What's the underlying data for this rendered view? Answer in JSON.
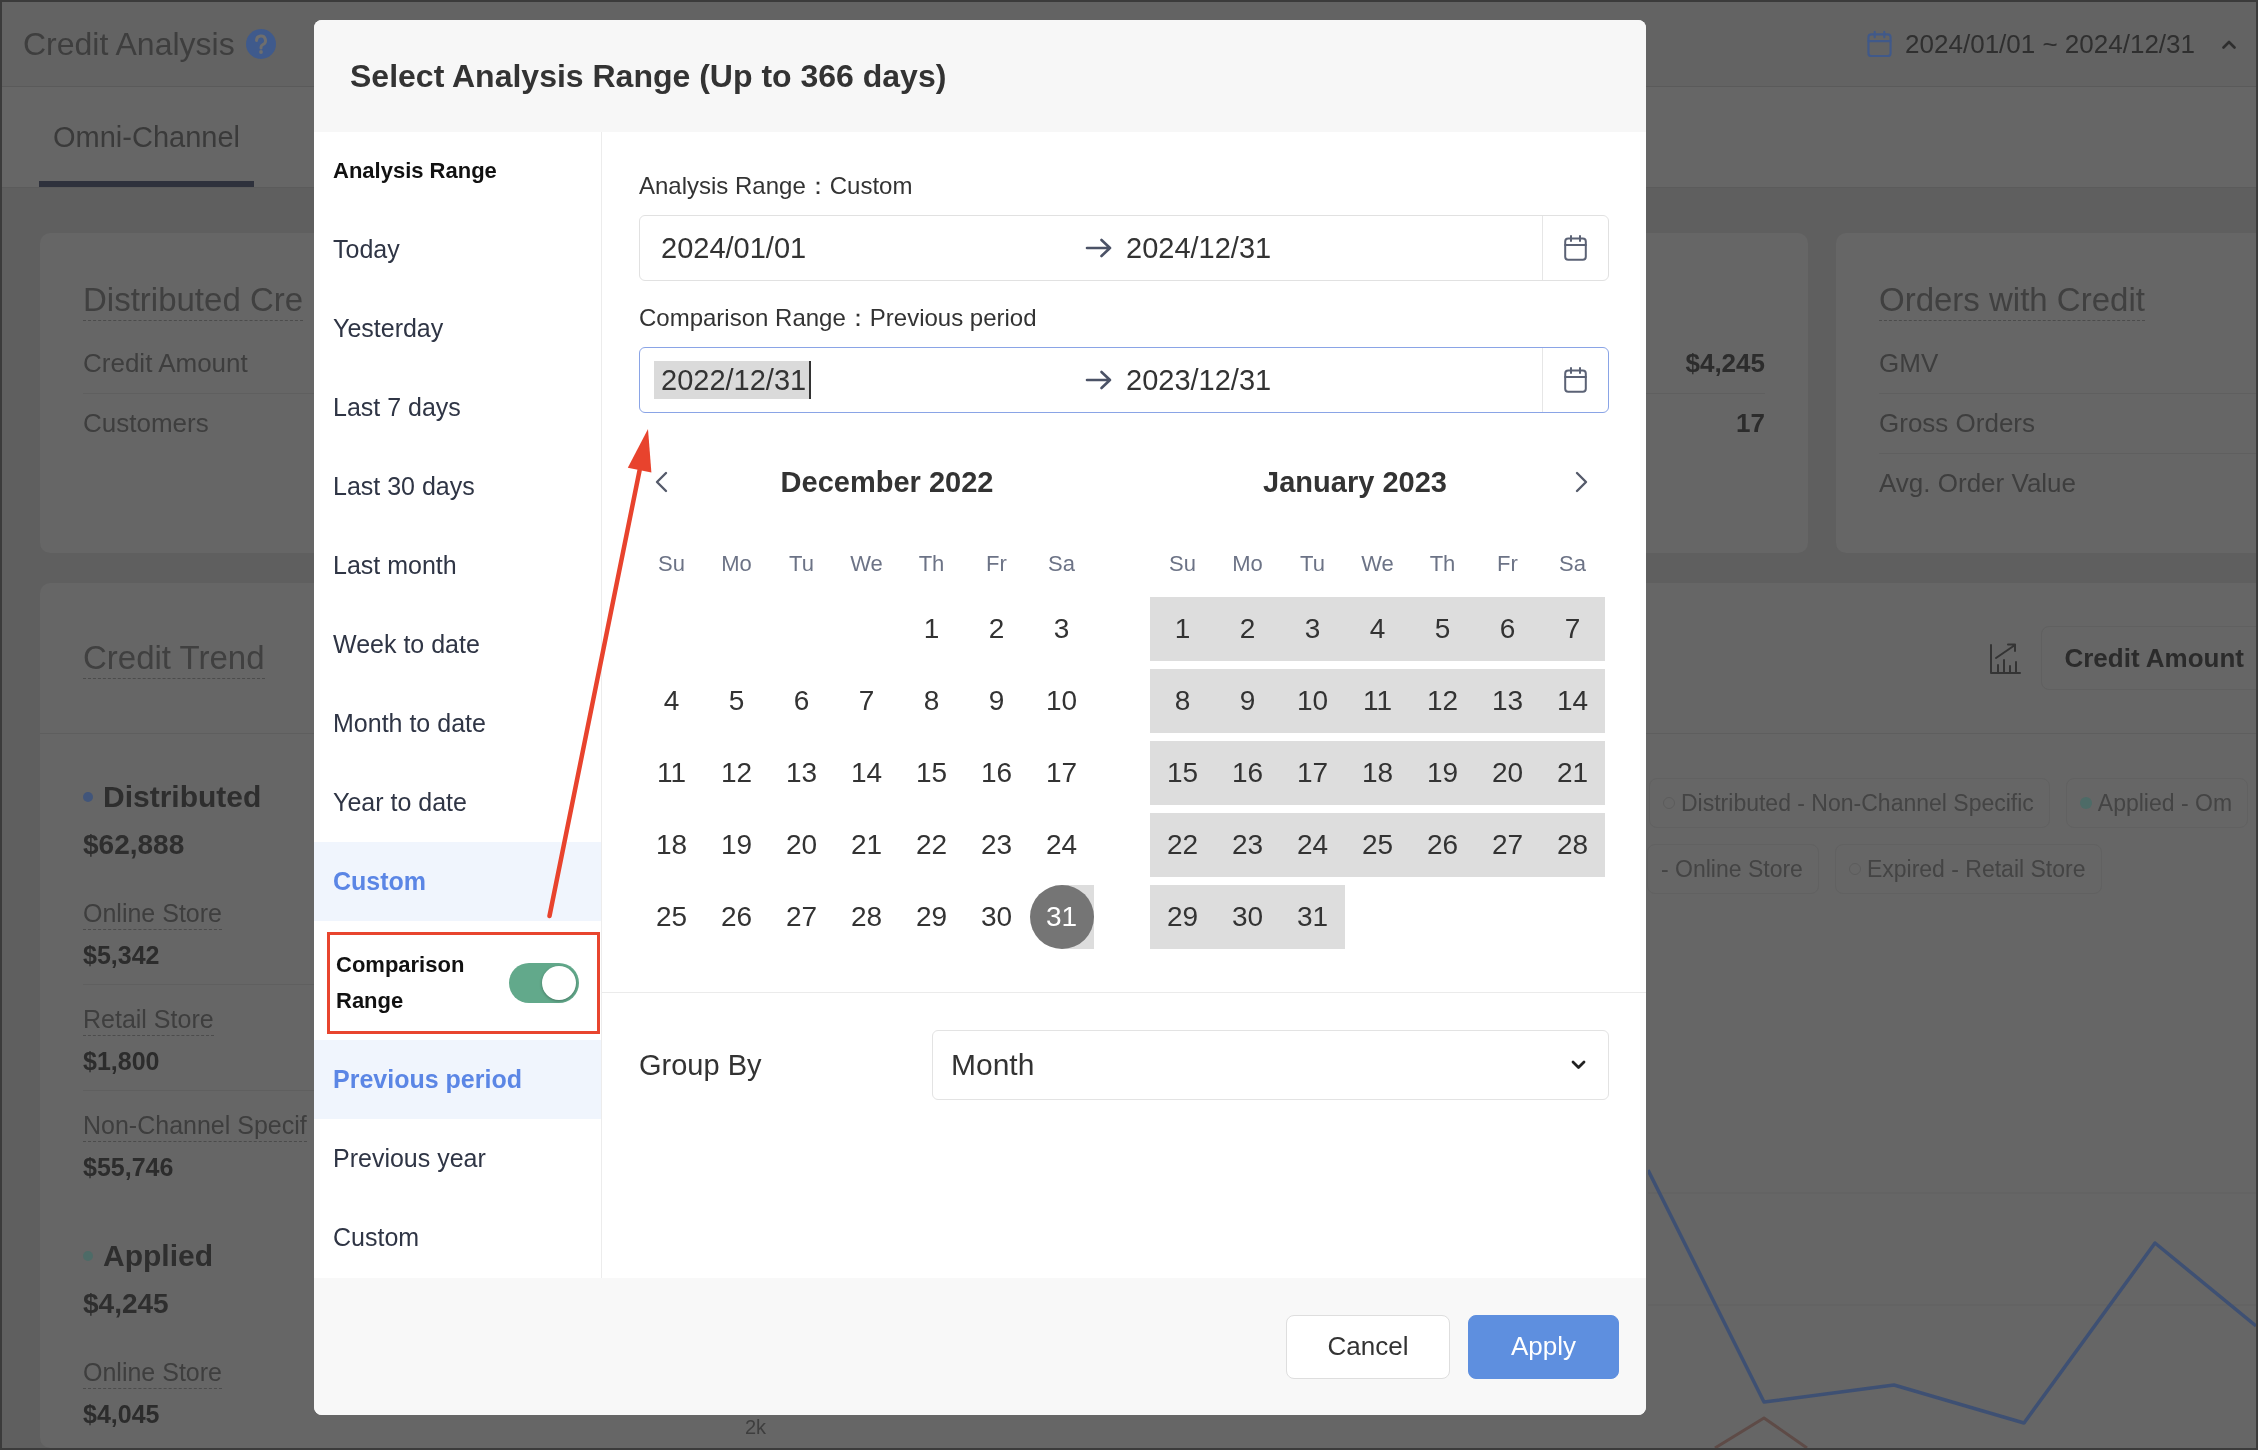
{
  "background": {
    "title": "Credit Analysis",
    "date_range": "2024/01/01 ~ 2024/12/31",
    "tabs": [
      {
        "label": "Omni-Channel",
        "selected": true
      }
    ],
    "summary_cards": [
      {
        "title": "Distributed Cre",
        "rows": [
          {
            "label": "Credit Amount",
            "value": "$4,245"
          },
          {
            "label": "Customers",
            "value": "17"
          }
        ]
      },
      {
        "title": "Orders with Credit",
        "rows": [
          {
            "label": "GMV"
          },
          {
            "label": "Gross Orders"
          },
          {
            "label": "Avg. Order Value"
          }
        ]
      }
    ],
    "trend": {
      "title": "Credit Trend",
      "metric_button": "Credit Amount",
      "groups": [
        {
          "name": "Distributed",
          "color": "#41557a",
          "total": "$62,888",
          "channels": [
            {
              "label": "Online Store",
              "value": "$5,342"
            },
            {
              "label": "Retail Store",
              "value": "$1,800"
            },
            {
              "label": "Non-Channel Specif",
              "value": "$55,746"
            }
          ]
        },
        {
          "name": "Applied",
          "color": "#4d6b67",
          "total": "$4,245",
          "channels": [
            {
              "label": "Online Store",
              "value": "$4,045"
            }
          ]
        }
      ],
      "legend_rows": [
        [
          {
            "label": "Distributed - Non-Channel Specific",
            "on": false
          },
          {
            "label": "Applied - Om",
            "on": true,
            "color": "#4d6b67"
          }
        ],
        [
          {
            "label": "- Online Store"
          },
          {
            "label": "Expired - Retail Store",
            "on": false
          }
        ]
      ],
      "axis_label": "2k"
    }
  },
  "dialog": {
    "title": "Select Analysis Range (Up to 366 days)",
    "sidebar": {
      "heading": "Analysis Range",
      "options": [
        {
          "label": "Today",
          "selected": false
        },
        {
          "label": "Yesterday",
          "selected": false
        },
        {
          "label": "Last 7 days",
          "selected": false
        },
        {
          "label": "Last 30 days",
          "selected": false
        },
        {
          "label": "Last month",
          "selected": false
        },
        {
          "label": "Week to date",
          "selected": false
        },
        {
          "label": "Month to date",
          "selected": false
        },
        {
          "label": "Year to date",
          "selected": false
        },
        {
          "label": "Custom",
          "selected": true
        }
      ],
      "comparison": {
        "label": "Comparison Range",
        "on": true,
        "highlighted": true
      },
      "comparison_options": [
        {
          "label": "Previous period",
          "selected": true
        },
        {
          "label": "Previous year",
          "selected": false
        },
        {
          "label": "Custom",
          "selected": false
        }
      ]
    },
    "range_fields": [
      {
        "label": "Analysis Range：Custom",
        "start": "2024/01/01",
        "end": "2024/12/31",
        "focused": false
      },
      {
        "label": "Comparison Range：Previous period",
        "start": "2022/12/31",
        "end": "2023/12/31",
        "focused": true
      }
    ],
    "calendar": {
      "months": [
        {
          "title": "December 2022",
          "weekdays": [
            "Su",
            "Mo",
            "Tu",
            "We",
            "Th",
            "Fr",
            "Sa"
          ],
          "weeks": [
            [
              {
                "label": "1",
                "in_range": false,
                "selected": false
              },
              {
                "label": "2",
                "in_range": false,
                "selected": false
              },
              {
                "label": "3",
                "in_range": false,
                "selected": false
              }
            ],
            [
              {
                "label": "4",
                "in_range": false,
                "selected": false
              },
              {
                "label": "5",
                "in_range": false,
                "selected": false
              },
              {
                "label": "6",
                "in_range": false,
                "selected": false
              },
              {
                "label": "7",
                "in_range": false,
                "selected": false
              },
              {
                "label": "8",
                "in_range": false,
                "selected": false
              },
              {
                "label": "9",
                "in_range": false,
                "selected": false
              },
              {
                "label": "10",
                "in_range": false,
                "selected": false
              }
            ],
            [
              {
                "label": "11",
                "in_range": false,
                "selected": false
              },
              {
                "label": "12",
                "in_range": false,
                "selected": false
              },
              {
                "label": "13",
                "in_range": false,
                "selected": false
              },
              {
                "label": "14",
                "in_range": false,
                "selected": false
              },
              {
                "label": "15",
                "in_range": false,
                "selected": false
              },
              {
                "label": "16",
                "in_range": false,
                "selected": false
              },
              {
                "label": "17",
                "in_range": false,
                "selected": false
              }
            ],
            [
              {
                "label": "18",
                "in_range": false,
                "selected": false
              },
              {
                "label": "19",
                "in_range": false,
                "selected": false
              },
              {
                "label": "20",
                "in_range": false,
                "selected": false
              },
              {
                "label": "21",
                "in_range": false,
                "selected": false
              },
              {
                "label": "22",
                "in_range": false,
                "selected": false
              },
              {
                "label": "23",
                "in_range": false,
                "selected": false
              },
              {
                "label": "24",
                "in_range": false,
                "selected": false
              }
            ],
            [
              {
                "label": "25",
                "in_range": false,
                "selected": false
              },
              {
                "label": "26",
                "in_range": false,
                "selected": false
              },
              {
                "label": "27",
                "in_range": false,
                "selected": false
              },
              {
                "label": "28",
                "in_range": false,
                "selected": false
              },
              {
                "label": "29",
                "in_range": false,
                "selected": false
              },
              {
                "label": "30",
                "in_range": false,
                "selected": false
              },
              {
                "label": "31",
                "in_range": true,
                "selected": true
              }
            ]
          ]
        },
        {
          "title": "January 2023",
          "weekdays": [
            "Su",
            "Mo",
            "Tu",
            "We",
            "Th",
            "Fr",
            "Sa"
          ],
          "weeks": [
            [
              {
                "label": "1",
                "in_range": true,
                "selected": false
              },
              {
                "label": "2",
                "in_range": true,
                "selected": false
              },
              {
                "label": "3",
                "in_range": true,
                "selected": false
              },
              {
                "label": "4",
                "in_range": true,
                "selected": false
              },
              {
                "label": "5",
                "in_range": true,
                "selected": false
              },
              {
                "label": "6",
                "in_range": true,
                "selected": false
              },
              {
                "label": "7",
                "in_range": true,
                "selected": false
              }
            ],
            [
              {
                "label": "8",
                "in_range": true,
                "selected": false
              },
              {
                "label": "9",
                "in_range": true,
                "selected": false
              },
              {
                "label": "10",
                "in_range": true,
                "selected": false
              },
              {
                "label": "11",
                "in_range": true,
                "selected": false
              },
              {
                "label": "12",
                "in_range": true,
                "selected": false
              },
              {
                "label": "13",
                "in_range": true,
                "selected": false
              },
              {
                "label": "14",
                "in_range": true,
                "selected": false
              }
            ],
            [
              {
                "label": "15",
                "in_range": true,
                "selected": false
              },
              {
                "label": "16",
                "in_range": true,
                "selected": false
              },
              {
                "label": "17",
                "in_range": true,
                "selected": false
              },
              {
                "label": "18",
                "in_range": true,
                "selected": false
              },
              {
                "label": "19",
                "in_range": true,
                "selected": false
              },
              {
                "label": "20",
                "in_range": true,
                "selected": false
              },
              {
                "label": "21",
                "in_range": true,
                "selected": false
              }
            ],
            [
              {
                "label": "22",
                "in_range": true,
                "selected": false
              },
              {
                "label": "23",
                "in_range": true,
                "selected": false
              },
              {
                "label": "24",
                "in_range": true,
                "selected": false
              },
              {
                "label": "25",
                "in_range": true,
                "selected": false
              },
              {
                "label": "26",
                "in_range": true,
                "selected": false
              },
              {
                "label": "27",
                "in_range": true,
                "selected": false
              },
              {
                "label": "28",
                "in_range": true,
                "selected": false
              }
            ],
            [
              {
                "label": "29",
                "in_range": true,
                "selected": false
              },
              {
                "label": "30",
                "in_range": true,
                "selected": false
              },
              {
                "label": "31",
                "in_range": true,
                "selected": false
              }
            ]
          ]
        }
      ]
    },
    "group_by": {
      "label": "Group By",
      "value": "Month"
    },
    "buttons": [
      {
        "label": "Cancel",
        "kind": "secondary"
      },
      {
        "label": "Apply",
        "kind": "primary"
      }
    ]
  }
}
